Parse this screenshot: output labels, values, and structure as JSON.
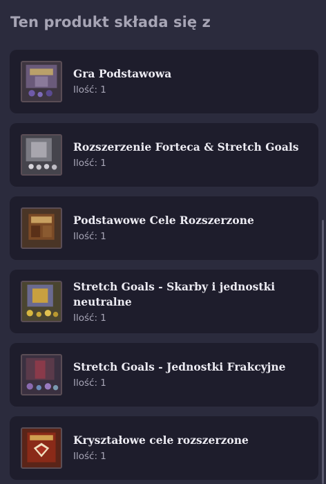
{
  "section": {
    "title": "Ten produkt składa się z"
  },
  "items": [
    {
      "name": "Gra Podstawowa",
      "quantity": "Ilość: 1",
      "thumb_color": "#6a4a3a"
    },
    {
      "name": "Rozszerzenie Forteca & Stretch Goals",
      "quantity": "Ilość: 1",
      "thumb_color": "#5a5a62"
    },
    {
      "name": "Podstawowe Cele Rozszerzone",
      "quantity": "Ilość: 1",
      "thumb_color": "#6b3a22"
    },
    {
      "name": "Stretch Goals - Skarby i jednostki neutralne",
      "quantity": "Ilość: 1",
      "thumb_color": "#8a7a3a"
    },
    {
      "name": "Stretch Goals - Jednostki Frakcyjne",
      "quantity": "Ilość: 1",
      "thumb_color": "#5a3a5a"
    },
    {
      "name": "Kryształowe cele rozszerzone",
      "quantity": "Ilość: 1",
      "thumb_color": "#7a2a1a"
    }
  ]
}
